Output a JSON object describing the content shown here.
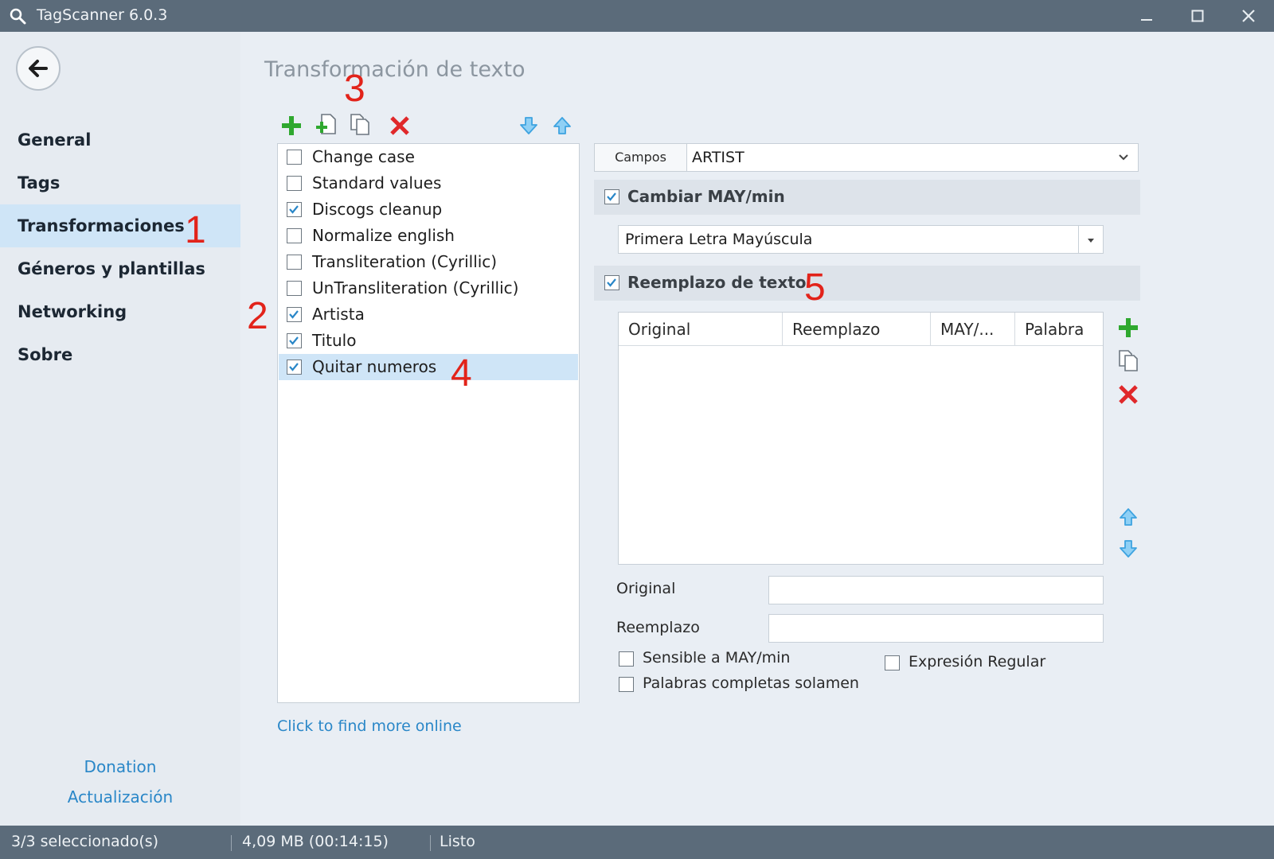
{
  "window": {
    "title": "TagScanner 6.0.3"
  },
  "sidebar": {
    "items": [
      {
        "label": "General"
      },
      {
        "label": "Tags"
      },
      {
        "label": "Transformaciones"
      },
      {
        "label": "Géneros y plantillas"
      },
      {
        "label": "Networking"
      },
      {
        "label": "Sobre"
      }
    ],
    "donation": "Donation",
    "update": "Actualización"
  },
  "annotations": [
    "1",
    "2",
    "3",
    "4",
    "5"
  ],
  "main": {
    "title": "Transformación de texto",
    "transforms": [
      {
        "label": "Change case",
        "checked": false
      },
      {
        "label": "Standard values",
        "checked": false
      },
      {
        "label": "Discogs cleanup",
        "checked": true
      },
      {
        "label": "Normalize english",
        "checked": false
      },
      {
        "label": "Transliteration (Cyrillic)",
        "checked": false
      },
      {
        "label": "UnTransliteration (Cyrillic)",
        "checked": false
      },
      {
        "label": "Artista",
        "checked": true
      },
      {
        "label": "Titulo",
        "checked": true
      },
      {
        "label": "Quitar numeros",
        "checked": true,
        "selected": true
      }
    ],
    "find_more": "Click to find more online"
  },
  "panel": {
    "campos_label": "Campos",
    "campos_value": "ARTIST",
    "case_section": {
      "label": "Cambiar MAY/min",
      "checked": true
    },
    "case_mode": "Primera Letra Mayúscula",
    "replace_section": {
      "label": "Reemplazo de texto",
      "checked": true
    },
    "grid_columns": [
      "Original",
      "Reemplazo",
      "MAY/...",
      "Palabra"
    ],
    "original_label": "Original",
    "original_value": "",
    "replacement_label": "Reemplazo",
    "replacement_value": "",
    "options": {
      "case_sensitive": {
        "label": "Sensible a MAY/min",
        "checked": false
      },
      "whole_words": {
        "label": "Palabras completas solamen",
        "checked": false
      },
      "regex": {
        "label": "Expresión Regular",
        "checked": false
      }
    }
  },
  "status": {
    "selection": "3/3 seleccionado(s)",
    "size": "4,09 MB (00:14:15)",
    "state": "Listo"
  },
  "colors": {
    "accent": "#2a87c8",
    "selected": "#cfe5f7",
    "add_green": "#2fa82f",
    "delete_red": "#e0282a",
    "arrow_blue": "#3ea3e0",
    "titlebar": "#5b6b7a"
  },
  "icons": {
    "add": "plus-icon",
    "duplicate": "add-file-icon",
    "copy": "copy-icon",
    "delete": "x-icon",
    "move_down": "arrow-down-icon",
    "move_up": "arrow-up-icon",
    "back": "arrow-left-icon",
    "app": "search-icon"
  }
}
